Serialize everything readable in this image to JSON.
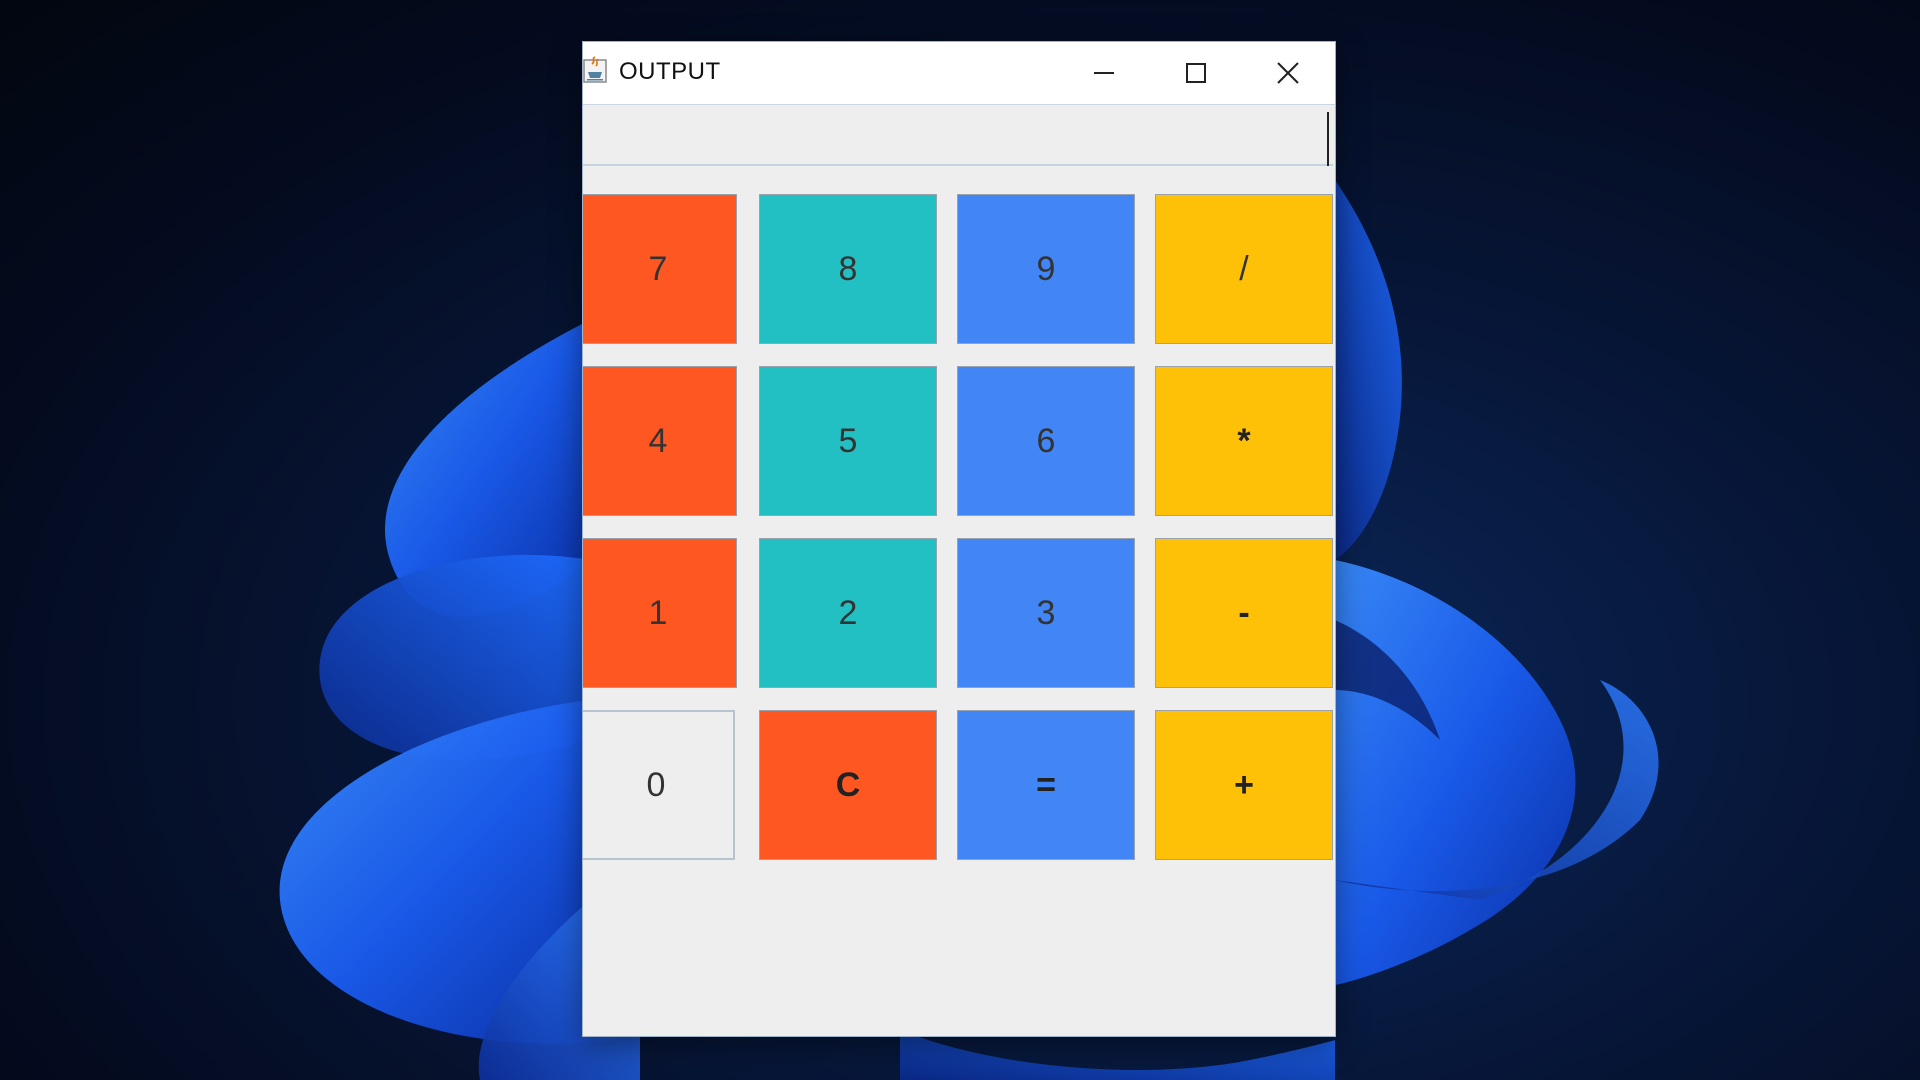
{
  "window": {
    "title": "OUTPUT",
    "controls": {
      "minimize_icon": "minimize-icon",
      "maximize_icon": "maximize-icon",
      "close_icon": "close-icon"
    }
  },
  "display": {
    "value": ""
  },
  "colors": {
    "orange": "#ff5722",
    "teal": "#22c0c3",
    "blue": "#4285f4",
    "yellow": "#ffc107",
    "light": "#eeeeee"
  },
  "keypad": {
    "row1": [
      "7",
      "8",
      "9",
      "/"
    ],
    "row2": [
      "4",
      "5",
      "6",
      "*"
    ],
    "row3": [
      "1",
      "2",
      "3",
      "-"
    ],
    "row4": [
      "0",
      "C",
      "=",
      "+"
    ]
  }
}
